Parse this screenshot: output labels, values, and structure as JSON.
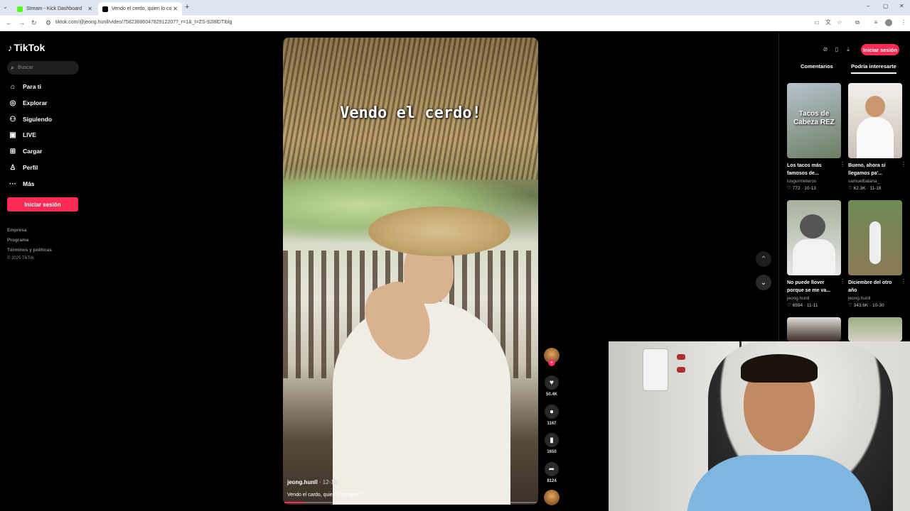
{
  "browser": {
    "tabs": [
      {
        "title": "Stream - Kick Dashboard",
        "active": false,
        "favicon_color": "#53fc18"
      },
      {
        "title": "Vendo el cerdo, quien lo co",
        "active": true,
        "favicon_color": "#000000"
      }
    ],
    "url": "tiktok.com/@jeong.hunll/video/7582368604782912207?_r=1&_t=ZS-92l8lDTIblg"
  },
  "sidebar": {
    "logo": "TikTok",
    "search_placeholder": "Buscar",
    "nav": [
      {
        "label": "Para ti",
        "icon": "home-icon"
      },
      {
        "label": "Explorar",
        "icon": "compass-icon"
      },
      {
        "label": "Siguiendo",
        "icon": "people-icon"
      },
      {
        "label": "LIVE",
        "icon": "live-icon"
      },
      {
        "label": "Cargar",
        "icon": "upload-icon"
      },
      {
        "label": "Perfil",
        "icon": "profile-icon"
      },
      {
        "label": "Más",
        "icon": "more-icon"
      }
    ],
    "login": "Iniciar sesión",
    "footer": [
      "Empresa",
      "Programa",
      "Términos y políticas"
    ],
    "copyright": "© 2025 TikTok"
  },
  "video": {
    "overlay_text": "Vendo el cerdo!",
    "author": "jeong.hunll",
    "date": " · 12-10",
    "description": "Vendo el cardo, quien lo compra?",
    "progress": 0.08,
    "likes": "50.4K",
    "comments": "1167",
    "saves": "1650",
    "shares": "8124"
  },
  "right_panel": {
    "login": "Iniciar sesión",
    "tabs": [
      "Comentarios",
      "Podría interesarte"
    ],
    "active_tab": "Podría interesarte",
    "cards": [
      {
        "thumb_text": "Tacos de Cabeza REZ",
        "title": "Los tacos más famosos de...",
        "user": "losgurmeteros",
        "stats": "♡ 772 · 10-13",
        "color1": "#9aa7b6",
        "color2": "#5a6b58"
      },
      {
        "thumb_text": "",
        "title": "Bueno, ahora sí llegamos pa'...",
        "user": "samuelbalana_",
        "stats": "♡ 62.3K · 11-18",
        "color1": "#e8e4df",
        "color2": "#cfc7bd"
      },
      {
        "thumb_text": "",
        "title": "No puede llover porque se me va...",
        "user": "jeong.hunll",
        "stats": "♡ 6594 · 11-11",
        "color1": "#8f9a86",
        "color2": "#e8e8e8"
      },
      {
        "thumb_text": "",
        "title": "Diciembre del otro año",
        "user": "jeong.hunll",
        "stats": "♡ 343.6K · 10-30",
        "color1": "#7f8f6a",
        "color2": "#5d6b45"
      }
    ]
  }
}
